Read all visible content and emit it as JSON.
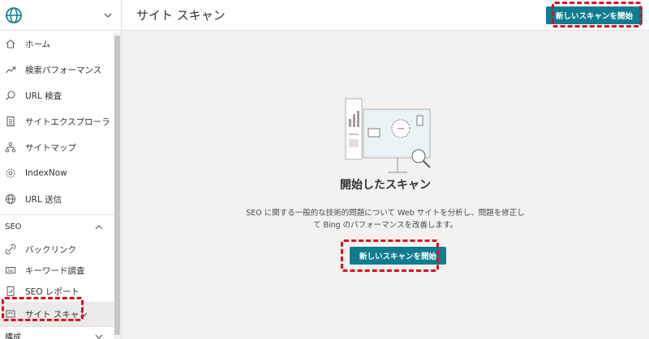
{
  "sidebar": {
    "items": [
      {
        "label": "ホーム",
        "icon": "home-icon"
      },
      {
        "label": "検索パフォーマンス",
        "icon": "trend-icon"
      },
      {
        "label": "URL 検査",
        "icon": "search-icon"
      },
      {
        "label": "サイトエクスプローラ",
        "icon": "document-icon"
      },
      {
        "label": "サイトマップ",
        "icon": "sitemap-icon"
      },
      {
        "label": "IndexNow",
        "icon": "gear-icon"
      },
      {
        "label": "URL 送信",
        "icon": "globe-icon"
      }
    ],
    "seo_section": "SEO",
    "seo_items": [
      {
        "label": "バックリンク",
        "icon": "link-icon"
      },
      {
        "label": "キーワード調査",
        "icon": "keyboard-icon"
      },
      {
        "label": "SEO レポート",
        "icon": "report-icon"
      },
      {
        "label": "サイト スキャン",
        "icon": "scan-icon"
      }
    ],
    "config_section": "構成"
  },
  "header": {
    "title": "サイト スキャン",
    "button_label": "新しいスキャンを開始"
  },
  "main": {
    "title": "開始したスキャン",
    "description": "SEO に関する一般的な技術的問題について Web サイトを分析し、問題を修正して Bing のパフォーマンスを改善します。",
    "button_label": "新しいスキャンを開始"
  },
  "colors": {
    "accent": "#0f7c90",
    "highlight": "#d9101a"
  }
}
